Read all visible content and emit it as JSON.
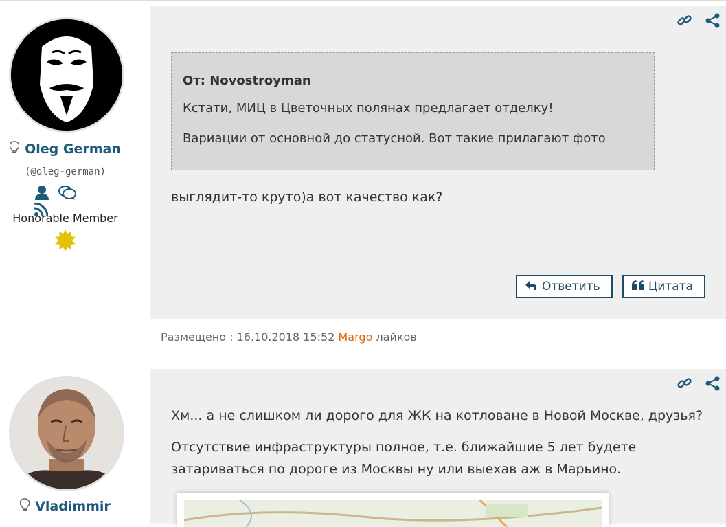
{
  "posts": [
    {
      "user": {
        "name": "Oleg German",
        "handle": "(@oleg-german)",
        "rank": "Honorable Member"
      },
      "quote": {
        "from": "От: Novostroyman",
        "lines": [
          "Кстати, МИЦ в Цветочных полянах предлагает отделку!",
          "Вариации от основной до статусной. Вот такие прилагают фото"
        ]
      },
      "text": [
        "выглядит-то круто)а вот качество как?"
      ],
      "buttons": {
        "reply": "Ответить",
        "quote": "Цитата"
      },
      "meta": {
        "prefix": "Размещено : 16.10.2018 15:52",
        "who": "Margo",
        "suffix": "лайков"
      }
    },
    {
      "user": {
        "name": "Vladimmir"
      },
      "text": [
        "Хм... а не слишком ли дорого для ЖК на котловане в Новой Москве, друзья?",
        "Отсутствие инфраструктуры полное, т.е. ближайшие 5 лет будете",
        "затариваться по дороге из Москвы ну или выехав аж в Марьино."
      ]
    }
  ],
  "icons": {
    "link": "link-icon",
    "share": "share-icon",
    "bulb": "lightbulb-icon",
    "profile": "user-icon",
    "messages": "chat-icon",
    "rss": "rss-icon",
    "rank_badge": "star-badge-icon",
    "reply": "reply-arrow-icon",
    "quote": "quote-icon"
  },
  "colors": {
    "accent": "#1e5a7a",
    "button_border": "#1e4a63",
    "liker": "#d9650a",
    "badge": "#e3c10a",
    "post_bg": "#efefef",
    "quote_bg": "#d8d8d8"
  }
}
